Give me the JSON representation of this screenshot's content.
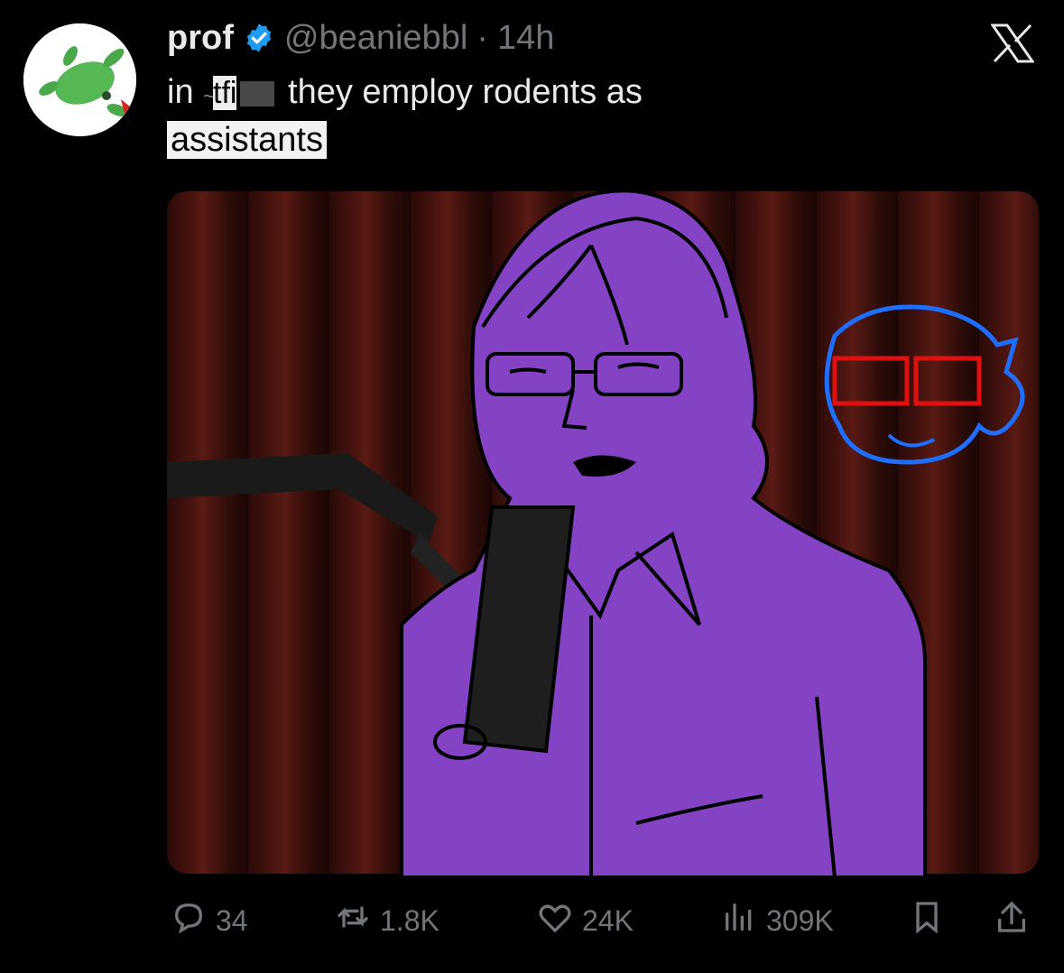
{
  "tweet": {
    "author_name": "prof",
    "handle": "@beaniebbl",
    "separator": "·",
    "time": "14h",
    "text_line1_prefix": "in",
    "text_line1_fragment": "tfi",
    "text_line1_suffix": "they employ rodents as",
    "text_line2": "assistants"
  },
  "metrics": {
    "replies": "34",
    "retweets": "1.8K",
    "likes": "24K",
    "views": "309K"
  },
  "icons": {
    "verified": "verified-badge-icon",
    "close": "x-logo-icon",
    "reply": "reply-icon",
    "retweet": "retweet-icon",
    "like": "heart-icon",
    "views": "views-icon",
    "bookmark": "bookmark-icon",
    "share": "share-icon"
  },
  "colors": {
    "background": "#000000",
    "text": "#e7e9ea",
    "muted": "#71767b",
    "verified": "#1d9bf0",
    "purple_fill": "#8442c4"
  }
}
